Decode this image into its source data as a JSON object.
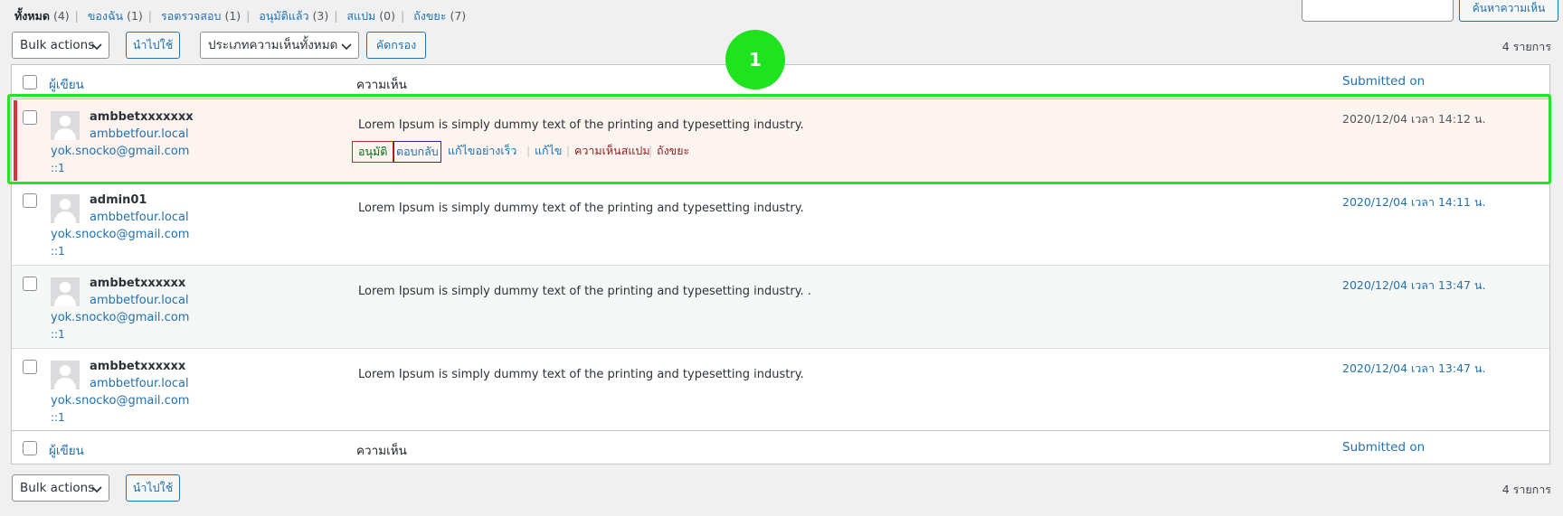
{
  "filters": [
    {
      "label": "ทั้งหมด",
      "count": "(4)",
      "current": true
    },
    {
      "label": "ของฉัน",
      "count": "(1)"
    },
    {
      "label": "รอตรวจสอบ",
      "count": "(1)"
    },
    {
      "label": "อนุมัติแล้ว",
      "count": "(3)"
    },
    {
      "label": "สแปม",
      "count": "(0)"
    },
    {
      "label": "ถังขยะ",
      "count": "(7)"
    }
  ],
  "search": {
    "button_label": "ค้นหาความเห็น",
    "value": ""
  },
  "tablenav": {
    "bulk_actions_label": "Bulk actions",
    "apply_label": "นำไปใช้",
    "comment_type_label": "ประเภทความเห็นทั้งหมด",
    "filter_label": "คัดกรอง",
    "displaying_num": "4 รายการ"
  },
  "columns": {
    "author": "ผู้เขียน",
    "comment": "ความเห็น",
    "date": "Submitted on"
  },
  "marker_label": "1",
  "row_actions": {
    "approve": "อนุมัติ",
    "reply": "ตอบกลับ",
    "quick_edit": "แก้ไขอย่างเร็ว",
    "edit": "แก้ไข",
    "spam": "ความเห็นสแปม",
    "trash": "ถังขยะ"
  },
  "comments": [
    {
      "author": "ambbetxxxxxxx",
      "site": "ambbetfour.local",
      "email": "yok.snocko@gmail.com",
      "ip": "::1",
      "text": "Lorem Ipsum is simply dummy text of the printing and typesetting industry.",
      "date": "2020/12/04 เวลา 14:12 น.",
      "status": "unapproved"
    },
    {
      "author": "admin01",
      "site": "ambbetfour.local",
      "email": "yok.snocko@gmail.com",
      "ip": "::1",
      "text": "Lorem Ipsum is simply dummy text of the printing and typesetting industry.",
      "date": "2020/12/04 เวลา 14:11 น.",
      "status": "approved"
    },
    {
      "author": "ambbetxxxxxx",
      "site": "ambbetfour.local",
      "email": "yok.snocko@gmail.com",
      "ip": "::1",
      "text": "Lorem Ipsum is simply dummy text of the printing and typesetting industry. .",
      "date": "2020/12/04 เวลา 13:47 น.",
      "status": "approved"
    },
    {
      "author": "ambbetxxxxxx",
      "site": "ambbetfour.local",
      "email": "yok.snocko@gmail.com",
      "ip": "::1",
      "text": "Lorem Ipsum is simply dummy text of the printing and typesetting industry.",
      "date": "2020/12/04 เวลา 13:47 น.",
      "status": "approved"
    }
  ],
  "colors": {
    "highlight": "#22e622",
    "accent": "#2271b1",
    "unapproved_bar": "#d63638"
  }
}
